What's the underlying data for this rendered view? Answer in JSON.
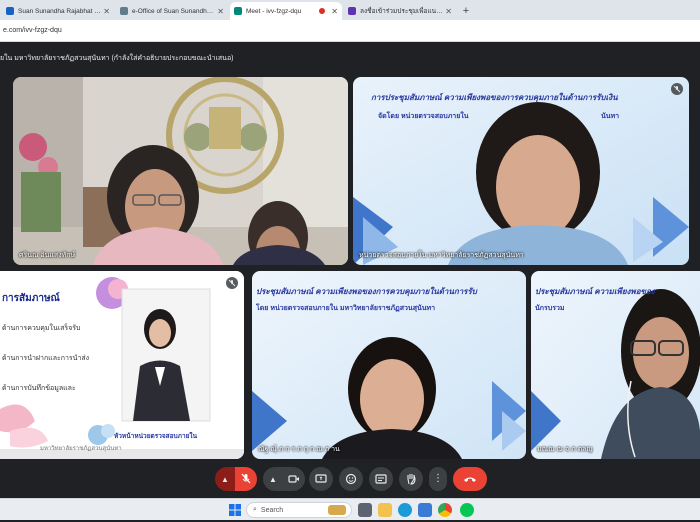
{
  "browser": {
    "tabs": [
      {
        "label": "Suan Sunandha Rajabhat Unive",
        "fav_color": "#1565c0",
        "active": false
      },
      {
        "label": "e-Office of Suan Sunandha Raja",
        "fav_color": "#607d8b",
        "active": false
      },
      {
        "label": "Meet - ivv-fzgz-dqu",
        "fav_color": "#00897b",
        "active": true
      },
      {
        "label": "ลงชื่อเข้าร่วมประชุมเพื่อแนะแนวในแต่ละครั้ง",
        "fav_color": "#5e35b1",
        "active": false
      }
    ],
    "new_tab_glyph": "+",
    "url": "e.com/ivv-fzgz-dqu"
  },
  "meet": {
    "presenting_title": "ยใน มหาวิทยาลัยราชภัฏสวนสุนันทา (กำลังใส่คำอธิบายประกอบขณะนำเสนอ)",
    "tiles": {
      "t1": {
        "name": "ศรินณ อินแสงทักษ์"
      },
      "t2": {
        "name": "หน่วยตรวจสอบภายใน มหาวิทยาลัยราชภัฏสวนสุนันทา",
        "slide_heading": "การประชุมสัมภาษณ์ ความเพียงพอของการควบคุมภายในด้านการรับเงิน",
        "slide_sub": "จัดโดย หน่วยตรวจสอบภายใน",
        "slide_sub2": "นันทา"
      },
      "t3": {
        "slide_heading": "การสัมภาษณ์",
        "bullets": [
          "ด้านการควบคุมในเสร็จรับ",
          "ด้านการนำฝากและการนำส่ง",
          "ด้านการบันทึกข้อมูลและ"
        ],
        "caption": "หัวหน้าหน่วยตรวจสอบภายใน",
        "footer": "มหาวิทยาลัยราชภัฏสวนสุนันทา"
      },
      "t4": {
        "name": "ณัฐ ณุ์ ภ ก ร ภ กุ ก ณ ภ าน",
        "slide_heading": "ประชุมสัมภาษณ์ ความเพียงพอของการควบคุมภายในด้านการรับ",
        "slide_sub": "โดย หน่วยตรวจสอบภายใน มหาวิทยาลัยราชภัฏสวนสุนันทา"
      },
      "t5": {
        "name": "มณณ ณ จ ภ ตลญ",
        "slide_heading": "ประชุมสัมภาษณ์ ความเพียงพอของ",
        "slide_sub": "นักรบรวม"
      }
    }
  },
  "taskbar": {
    "search_placeholder": "Search"
  },
  "colors": {
    "meet_bg": "#202124",
    "end_call": "#ea4335",
    "mic_off": "#8c1d18",
    "slide_text": "#2a3aa0"
  }
}
